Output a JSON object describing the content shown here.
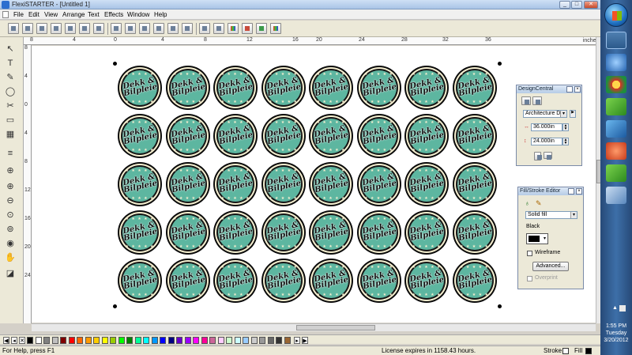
{
  "window": {
    "title": "FlexiSTARTER - [Untitled 1]",
    "min": "_",
    "max": "□",
    "close": "✕"
  },
  "menu": {
    "items": [
      "File",
      "Edit",
      "View",
      "Arrange",
      "Text",
      "Effects",
      "Window",
      "Help"
    ]
  },
  "ruler": {
    "unit": "inches",
    "h_labels": [
      "8",
      "4",
      "0",
      "4",
      "8",
      "12",
      "16",
      "20",
      "24",
      "28",
      "32",
      "36"
    ],
    "v_labels": [
      "8",
      "4",
      "0",
      "4",
      "8",
      "12",
      "16",
      "20",
      "24"
    ]
  },
  "sticker": {
    "line1": "Dekk &",
    "line2": "Bilpleie",
    "stars": "★ ★ ★ ★ ★",
    "rows": 5,
    "cols": 8,
    "colors": {
      "outer": "#0b0b0b",
      "cream": "#f5efd0",
      "face": "#5db6a0"
    }
  },
  "design_central": {
    "title": "DesignCentral",
    "dropdown": "Architecture D",
    "width": "36.000in",
    "height": "24.000in"
  },
  "fill_stroke": {
    "title": "Fill/Stroke Editor",
    "fill_type": "Solid fill",
    "color_name": "Black",
    "wireframe": "Wireframe",
    "advanced": "Advanced...",
    "overprint": "Overprint"
  },
  "palette": {
    "colors": [
      "#000000",
      "#ffffff",
      "#808080",
      "#c0c0c0",
      "#800000",
      "#ff0000",
      "#ff6600",
      "#ff9900",
      "#ffcc00",
      "#ffff00",
      "#99cc00",
      "#00ff00",
      "#008000",
      "#00ff99",
      "#00ffff",
      "#0099ff",
      "#0000ff",
      "#000080",
      "#6600cc",
      "#9900ff",
      "#ff00ff",
      "#ff0099",
      "#cc6699",
      "#ffccff",
      "#ccffcc",
      "#ccffff",
      "#99ccff",
      "#cccccc",
      "#999999",
      "#666666",
      "#333333",
      "#996633"
    ]
  },
  "status": {
    "help": "For Help, press F1",
    "license": "License expires in 1158.43 hours.",
    "stroke": "Stroke",
    "fill": "Fill"
  },
  "taskbar": {
    "time": "1:55 PM",
    "day": "Tuesday",
    "date": "3/20/2012"
  }
}
